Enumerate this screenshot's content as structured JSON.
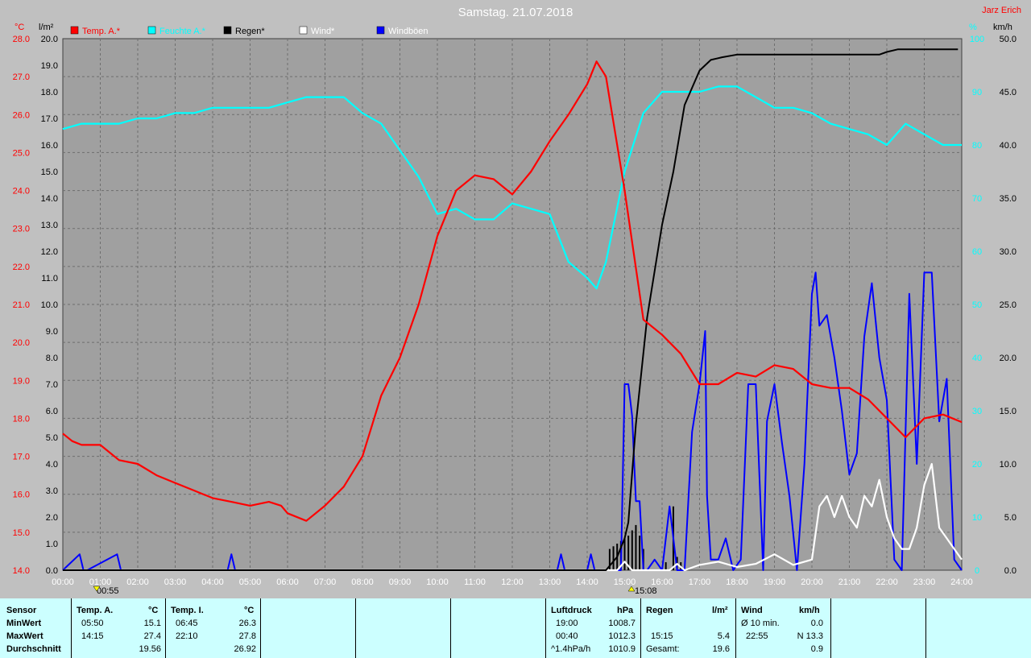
{
  "title": "Samstag. 21.07.2018",
  "author": "Jarz Erich",
  "legend": [
    {
      "label": "Temp. A.*",
      "color": "#ff0000"
    },
    {
      "label": "Feuchte A.*",
      "color": "#00ffff"
    },
    {
      "label": "Regen*",
      "color": "#000000"
    },
    {
      "label": "Wind*",
      "color": "#ffffff"
    },
    {
      "label": "Windböen",
      "color": "#0000ff"
    }
  ],
  "units": {
    "temp": "°C",
    "rain": "l/m²",
    "hum": "%",
    "wind": "km/h"
  },
  "markers": {
    "min_temp_time": "00:55",
    "max_temp_time": "15:08"
  },
  "chart_data": {
    "type": "line",
    "title": "Samstag. 21.07.2018",
    "x_ticks": [
      "00:00",
      "01:00",
      "02:00",
      "03:00",
      "04:00",
      "05:00",
      "06:00",
      "07:00",
      "08:00",
      "09:00",
      "10:00",
      "11:00",
      "12:00",
      "13:00",
      "14:00",
      "15:00",
      "16:00",
      "17:00",
      "18:00",
      "19:00",
      "20:00",
      "21:00",
      "22:00",
      "23:00",
      "24:00"
    ],
    "xlim": [
      0,
      24
    ],
    "axes": {
      "temp": {
        "label": "°C",
        "range": [
          14,
          28
        ],
        "ticks": [
          "14.0",
          "15.0",
          "16.0",
          "17.0",
          "18.0",
          "19.0",
          "20.0",
          "21.0",
          "22.0",
          "23.0",
          "24.0",
          "25.0",
          "26.0",
          "27.0",
          "28.0"
        ]
      },
      "rain": {
        "label": "l/m²",
        "range": [
          0,
          20
        ],
        "ticks": [
          "0.0",
          "1.0",
          "2.0",
          "3.0",
          "4.0",
          "5.0",
          "6.0",
          "7.0",
          "8.0",
          "9.0",
          "10.0",
          "11.0",
          "12.0",
          "13.0",
          "14.0",
          "15.0",
          "16.0",
          "17.0",
          "18.0",
          "19.0",
          "20.0"
        ]
      },
      "hum": {
        "label": "%",
        "range": [
          0,
          100
        ],
        "ticks": [
          "0",
          "10",
          "20",
          "30",
          "40",
          "50",
          "60",
          "70",
          "80",
          "90",
          "100"
        ]
      },
      "wind": {
        "label": "km/h",
        "range": [
          0,
          50
        ],
        "ticks": [
          "0.0",
          "5.0",
          "10.0",
          "15.0",
          "20.0",
          "25.0",
          "30.0",
          "35.0",
          "40.0",
          "45.0",
          "50.0"
        ]
      }
    },
    "grid": true,
    "series": [
      {
        "name": "Temp. A.*",
        "axis": "temp",
        "color": "#ff0000",
        "x": [
          0,
          0.25,
          0.5,
          1,
          1.5,
          2,
          2.5,
          3,
          3.5,
          4,
          4.5,
          5,
          5.5,
          5.83,
          6,
          6.5,
          7,
          7.5,
          8,
          8.5,
          9,
          9.5,
          10,
          10.5,
          11,
          11.5,
          12,
          12.5,
          13,
          13.5,
          14,
          14.25,
          14.5,
          15,
          15.5,
          16,
          16.5,
          17,
          17.5,
          18,
          18.5,
          19,
          19.5,
          20,
          20.5,
          21,
          21.5,
          22,
          22.5,
          23,
          23.5,
          24
        ],
        "y": [
          17.6,
          17.4,
          17.3,
          17.3,
          16.9,
          16.8,
          16.5,
          16.3,
          16.1,
          15.9,
          15.8,
          15.7,
          15.8,
          15.7,
          15.5,
          15.3,
          15.7,
          16.2,
          17.0,
          18.6,
          19.6,
          21.0,
          22.8,
          24.0,
          24.4,
          24.3,
          23.9,
          24.5,
          25.3,
          26.0,
          26.8,
          27.4,
          27.0,
          24.0,
          20.6,
          20.2,
          19.7,
          18.9,
          18.9,
          19.2,
          19.1,
          19.4,
          19.3,
          18.9,
          18.8,
          18.8,
          18.5,
          18.0,
          17.5,
          18.0,
          18.1,
          17.9
        ]
      },
      {
        "name": "Feuchte A.*",
        "axis": "hum",
        "color": "#00ffff",
        "x": [
          0,
          0.5,
          1,
          1.5,
          2,
          2.5,
          3,
          3.5,
          4,
          4.5,
          5,
          5.5,
          6,
          6.5,
          7,
          7.5,
          8,
          8.5,
          9,
          9.5,
          10,
          10.5,
          11,
          11.5,
          12,
          12.5,
          13,
          13.5,
          14,
          14.25,
          14.5,
          15,
          15.5,
          16,
          16.5,
          17,
          17.5,
          18,
          18.5,
          19,
          19.5,
          20,
          20.5,
          21,
          21.5,
          22,
          22.5,
          23,
          23.5,
          24
        ],
        "y": [
          83,
          84,
          84,
          84,
          85,
          85,
          86,
          86,
          87,
          87,
          87,
          87,
          88,
          89,
          89,
          89,
          86,
          84,
          79,
          74,
          67,
          68,
          66,
          66,
          69,
          68,
          67,
          58,
          55,
          53,
          58,
          75,
          86,
          90,
          90,
          90,
          91,
          91,
          89,
          87,
          87,
          86,
          84,
          83,
          82,
          80,
          84,
          82,
          80,
          80
        ]
      },
      {
        "name": "Regen*",
        "axis": "rain",
        "color": "#000000",
        "x": [
          0,
          14.5,
          14.8,
          15,
          15.1,
          15.3,
          15.6,
          16,
          16.3,
          16.6,
          17,
          17.3,
          17.6,
          18,
          19,
          20,
          21,
          21.8,
          22,
          22.3,
          23,
          23.9
        ],
        "y": [
          0,
          0,
          0.5,
          1.2,
          1.8,
          5.5,
          9.5,
          13.0,
          15.0,
          17.5,
          18.8,
          19.2,
          19.3,
          19.4,
          19.4,
          19.4,
          19.4,
          19.4,
          19.5,
          19.6,
          19.6,
          19.6
        ]
      },
      {
        "name": "Wind*",
        "axis": "wind",
        "color": "#ffffff",
        "x": [
          0,
          14.8,
          15,
          15.2,
          16.2,
          16.4,
          16.6,
          17,
          17.5,
          18,
          18.5,
          19,
          19.5,
          20,
          20.2,
          20.4,
          20.6,
          20.8,
          21,
          21.2,
          21.4,
          21.6,
          21.8,
          22,
          22.2,
          22.4,
          22.6,
          22.8,
          23,
          23.2,
          23.4,
          23.6,
          23.8,
          24
        ],
        "y": [
          0,
          0,
          0.8,
          0,
          0,
          0.6,
          0,
          0.5,
          0.8,
          0.3,
          0.6,
          1.5,
          0.5,
          1.0,
          6.0,
          7.0,
          5.0,
          7.0,
          5.0,
          4.0,
          7.0,
          6.0,
          8.5,
          5.0,
          3.0,
          2.0,
          2.0,
          4.0,
          8.0,
          10.0,
          4.0,
          3.0,
          2.0,
          1.0
        ]
      },
      {
        "name": "Windböen",
        "axis": "wind",
        "color": "#0000ff",
        "x": [
          0,
          0.45,
          0.55,
          0.65,
          1.45,
          1.55,
          1.65,
          4.4,
          4.5,
          4.6,
          13.2,
          13.3,
          13.4,
          14,
          14.1,
          14.2,
          14.9,
          15,
          15.1,
          15.2,
          15.3,
          15.4,
          15.5,
          15.6,
          15.8,
          16,
          16.2,
          16.3,
          16.4,
          16.6,
          16.8,
          17,
          17.15,
          17.2,
          17.3,
          17.5,
          17.7,
          17.9,
          18.1,
          18.3,
          18.5,
          18.7,
          18.8,
          19,
          19.2,
          19.4,
          19.6,
          19.8,
          20,
          20.1,
          20.2,
          20.4,
          20.6,
          20.8,
          21,
          21.2,
          21.4,
          21.6,
          21.8,
          22,
          22.2,
          22.4,
          22.6,
          22.8,
          23,
          23.2,
          23.4,
          23.6,
          23.8,
          24
        ],
        "y": [
          0,
          1.5,
          0,
          0,
          1.5,
          0,
          0,
          0,
          1.5,
          0,
          0,
          1.5,
          0,
          0,
          1.5,
          0,
          0,
          17.5,
          17.5,
          14.5,
          6.5,
          6.5,
          0,
          0,
          1,
          0,
          6,
          3,
          0,
          0,
          13,
          17.5,
          22.5,
          7,
          1,
          1,
          3,
          0,
          1,
          17.5,
          17.5,
          0,
          14,
          17.5,
          12,
          7,
          0,
          10,
          26,
          28,
          23,
          24,
          20,
          15,
          9,
          11,
          22,
          27,
          20,
          16,
          1,
          0,
          26,
          10,
          28,
          28,
          14,
          18,
          1,
          0
        ]
      }
    ],
    "rain_bars": {
      "x": [
        14.6,
        14.7,
        14.8,
        14.9,
        15.0,
        15.1,
        15.2,
        15.3,
        15.4,
        15.5,
        16.1,
        16.3,
        16.4,
        16.5
      ],
      "y": [
        0.8,
        0.9,
        1.0,
        1.1,
        1.2,
        1.3,
        1.5,
        1.7,
        1.3,
        0.8,
        0.3,
        2.4,
        0.5,
        0.3
      ]
    }
  },
  "table": {
    "rows": [
      "Sensor",
      "MinWert",
      "MaxWert",
      "Durchschnitt"
    ],
    "temp_a": {
      "header": "Temp. A.",
      "unit": "°C",
      "min_time": "05:50",
      "min": "15.1",
      "max_time": "14:15",
      "max": "27.4",
      "avg": "19.56"
    },
    "temp_i": {
      "header": "Temp. I.",
      "unit": "°C",
      "min_time": "06:45",
      "min": "26.3",
      "max_time": "22:10",
      "max": "27.8",
      "avg": "26.92"
    },
    "pressure": {
      "header": "Luftdruck",
      "unit": "hPa",
      "min_time": "19:00",
      "min": "1008.7",
      "max_time": "00:40",
      "max": "1012.3",
      "trend_label": "^1.4hPa/h",
      "trend": "1010.9"
    },
    "rain": {
      "header": "Regen",
      "unit": "l/m²",
      "max_time": "15:15",
      "max": "5.4",
      "total_label": "Gesamt:",
      "total": "19.6"
    },
    "wind": {
      "header": "Wind",
      "unit": "km/h",
      "avg10_label": "Ø 10 min.",
      "avg10": "0.0",
      "max_time": "22:55",
      "max": "N 13.3",
      "avg": "0.9"
    }
  }
}
